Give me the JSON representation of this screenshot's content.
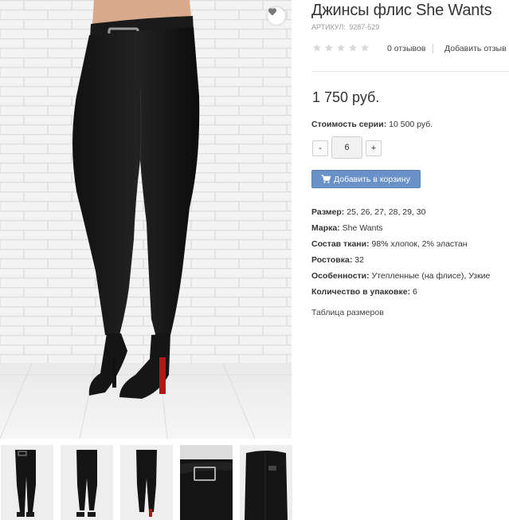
{
  "product": {
    "title": "Джинсы флис She Wants",
    "sku_label": "АРТИКУЛ:",
    "sku_value": "9287-529",
    "rating": 0,
    "rating_max": 5,
    "reviews_label": "0 отзывов",
    "add_review_label": "Добавить отзыв",
    "price": "1 750 руб.",
    "series_label": "Стоимость серии:",
    "series_value": "10 500 руб.",
    "quantity": "6",
    "qty_minus": "-",
    "qty_plus": "+",
    "add_to_cart_label": "Добавить в корзину",
    "specs": [
      {
        "label": "Размер:",
        "value": "25, 26, 27, 28, 29, 30"
      },
      {
        "label": "Марка:",
        "value": "She Wants"
      },
      {
        "label": "Состав ткани:",
        "value": "98% хлопок, 2% эластан"
      },
      {
        "label": "Ростовка:",
        "value": "32"
      },
      {
        "label": "Особенности:",
        "value": "Утепленные (на флисе), Узкие"
      },
      {
        "label": "Количество в упаковке:",
        "value": "6"
      }
    ],
    "size_table_label": "Таблица размеров"
  },
  "icons": {
    "favorite": "heart-icon",
    "cart": "cart-icon",
    "star": "star-icon"
  },
  "colors": {
    "accent_button": "#6a92c9",
    "star_empty": "#d9d9d9",
    "muted_text": "#9a9a9a"
  },
  "gallery": {
    "thumbnail_count": 5,
    "main_image": "black-skinny-jeans-model-photo"
  }
}
